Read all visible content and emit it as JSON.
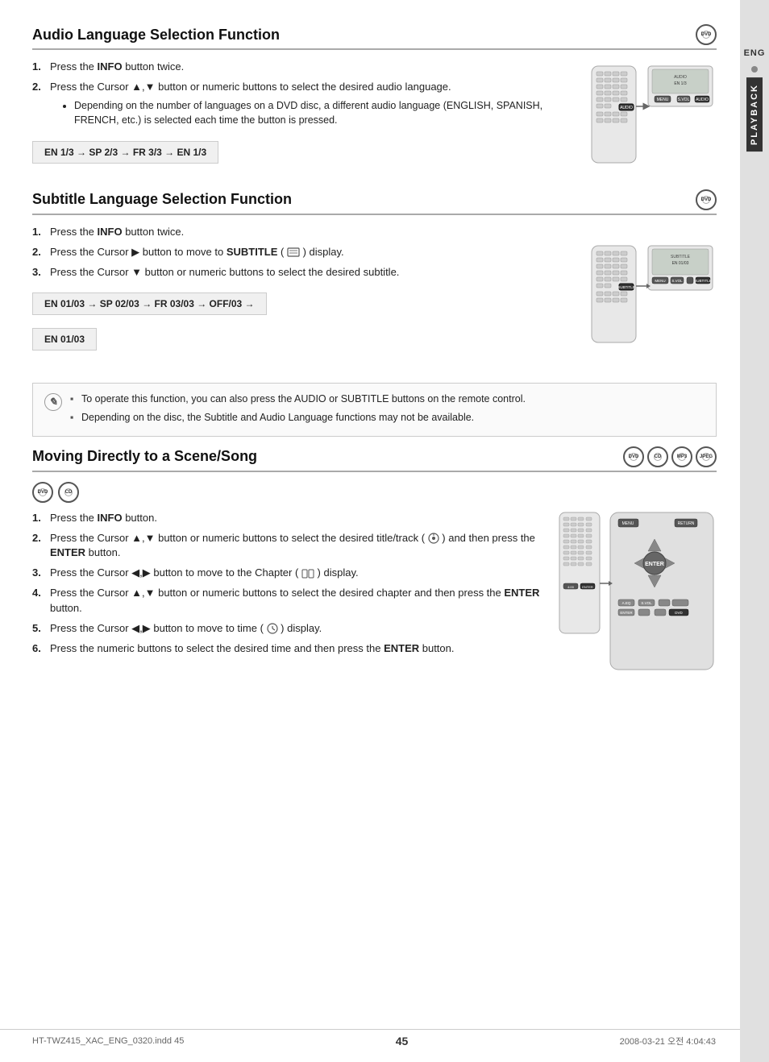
{
  "page": {
    "number": "45",
    "footer_left": "HT-TWZ415_XAC_ENG_0320.indd   45",
    "footer_right": "2008-03-21   오전 4:04:43"
  },
  "sidebar": {
    "lang_label": "ENG",
    "playback_label": "PLAYBACK"
  },
  "section1": {
    "title": "Audio Language Selection Function",
    "badge": "DVD",
    "steps": [
      {
        "num": "1.",
        "text": "Press the ",
        "bold": "INFO",
        "text2": " button twice."
      },
      {
        "num": "2.",
        "text": "Press the Cursor ▲,▼ button or numeric buttons to select the desired audio language."
      }
    ],
    "bullet": "Depending on the number of languages on a DVD disc, a different audio language (ENGLISH, SPANISH, FRENCH, etc.) is selected each time the button is pressed.",
    "formula": "EN 1/3 → SP 2/3 → FR 3/3 → EN 1/3"
  },
  "section2": {
    "title": "Subtitle Language Selection Function",
    "badge": "DVD",
    "steps": [
      {
        "num": "1.",
        "text": "Press the ",
        "bold": "INFO",
        "text2": " button twice."
      },
      {
        "num": "2.",
        "text": "Press the Cursor ▶ button to move to ",
        "bold": "SUBTITLE",
        "text2": " (    ) display."
      },
      {
        "num": "3.",
        "text": "Press the Cursor ▼ button or numeric buttons to select the desired subtitle."
      }
    ],
    "formula_line1": "EN 01/03 → SP 02/03 → FR 03/03 → OFF/03 →",
    "formula_line2": "EN 01/03"
  },
  "note": {
    "bullets": [
      "To operate this function, you can also press the AUDIO or SUBTITLE buttons on the remote control.",
      "Depending on the disc, the Subtitle and Audio Language functions may not be available."
    ]
  },
  "section3": {
    "title": "Moving Directly to a Scene/Song",
    "badges": [
      "DVD",
      "CD",
      "MP3",
      "JPEG"
    ],
    "sub_badges": [
      "DVD",
      "CD"
    ],
    "steps": [
      {
        "num": "1.",
        "text": "Press the ",
        "bold": "INFO",
        "text2": " button."
      },
      {
        "num": "2.",
        "text": "Press the Cursor ▲,▼ button or numeric buttons to select the desired title/track (    )  and then press the ",
        "bold": "ENTER",
        "text2": " button."
      },
      {
        "num": "3.",
        "text": "Press the Cursor ◀,▶ button to move to the Chapter (    ) display."
      },
      {
        "num": "4.",
        "text": "Press the Cursor ▲,▼ button or numeric buttons to select the desired chapter and then press the ",
        "bold": "ENTER",
        "text2": " button."
      },
      {
        "num": "5.",
        "text": "Press the Cursor ◀,▶ button to move to time (    ) display."
      },
      {
        "num": "6.",
        "text": "Press the numeric buttons to select the desired time and then press the ",
        "bold": "ENTER",
        "text2": " button."
      }
    ]
  }
}
